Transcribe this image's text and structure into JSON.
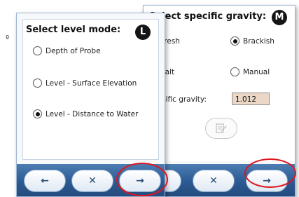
{
  "stray_mark": "º",
  "screen_l": {
    "title": "Select level mode:",
    "badge": "L",
    "options": [
      {
        "label": "Depth of Probe",
        "checked": false
      },
      {
        "label": "Level - Surface Elevation",
        "checked": false
      },
      {
        "label": "Level - Distance to Water",
        "checked": true
      }
    ],
    "nav": {
      "back": "←",
      "cancel": "✕",
      "next": "→"
    }
  },
  "screen_m": {
    "title": "Select specific gravity:",
    "badge": "M",
    "options": [
      {
        "label": "Fresh",
        "checked": false
      },
      {
        "label": "Brackish",
        "checked": true
      },
      {
        "label": "Salt",
        "checked": false
      },
      {
        "label": "Manual",
        "checked": false
      }
    ],
    "sg_label": "Specific gravity:",
    "sg_value": "1.012",
    "nav": {
      "back": "←",
      "cancel": "✕",
      "next": "→"
    }
  },
  "colors": {
    "highlight_ring": "#e0141e",
    "nav_bar": "#2c5a92",
    "badge": "#151515"
  }
}
